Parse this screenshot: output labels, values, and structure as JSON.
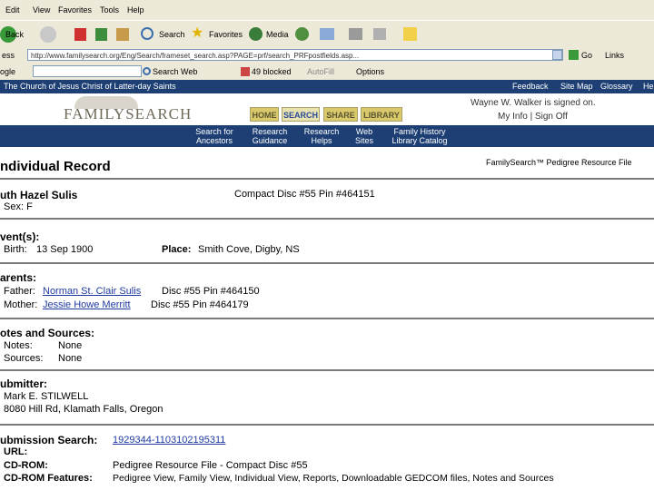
{
  "browser": {
    "menu": [
      "Edit",
      "View",
      "Favorites",
      "Tools",
      "Help"
    ],
    "toolbar": {
      "back": "Back",
      "search": "Search",
      "favorites": "Favorites",
      "media": "Media"
    },
    "address": {
      "label": "ess",
      "url": "http://www.familysearch.org/Eng/Search/frameset_search.asp?PAGE=prf/search_PRFpostfields.asp...",
      "go": "Go",
      "links": "Links"
    },
    "google": {
      "label": "ogle",
      "search_web": "Search Web",
      "blocked": "49 blocked",
      "autofill": "AutoFill",
      "options": "Options"
    }
  },
  "site": {
    "church": "The Church of Jesus Christ of Latter-day Saints",
    "top_links": [
      "Feedback",
      "Site Map",
      "Glossary",
      "He"
    ],
    "logo": "FAMILYSEARCH",
    "tabs": [
      "HOME",
      "SEARCH",
      "SHARE",
      "LIBRARY"
    ],
    "signed_in": "Wayne W. Walker is signed on.",
    "account_links": "My Info | Sign Off",
    "subnav": [
      [
        "Search for",
        "Ancestors"
      ],
      [
        "Research",
        "Guidance"
      ],
      [
        "Research",
        "Helps"
      ],
      [
        "Web",
        "Sites"
      ],
      [
        "Family History",
        "Library Catalog"
      ]
    ]
  },
  "record": {
    "title": "ndividual Record",
    "source_file": "FamilySearch™ Pedigree Resource File",
    "name": "uth Hazel Sulis",
    "disc_pin": "Compact Disc #55   Pin #464151",
    "sex": "Sex: F",
    "events_heading": "vent(s):",
    "birth_label": "Birth:",
    "birth_date": "13 Sep 1900",
    "place_label": "Place:",
    "place": "Smith Cove, Digby, NS",
    "parents_heading": "arents:",
    "father_label": "Father:",
    "father": "Norman St. Clair Sulis",
    "father_ref": "Disc #55   Pin #464150",
    "mother_label": "Mother:",
    "mother": "Jessie Howe Merritt",
    "mother_ref": "Disc #55   Pin #464179",
    "notes_heading": "otes and Sources:",
    "notes_label": "Notes:",
    "notes_value": "None",
    "sources_label": "Sources:",
    "sources_value": "None",
    "submitter_heading": "ubmitter:",
    "submitter_name": "Mark E. STILWELL",
    "submitter_address": "8080 Hill Rd, Klamath Falls, Oregon",
    "submission_label": "ubmission Search:",
    "submission_id": "1929344-1103102195311",
    "url_label": "URL:",
    "cdrom_label": "CD-ROM:",
    "cdrom_value": "Pedigree Resource File - Compact Disc #55",
    "features_label": "CD-ROM Features:",
    "features_value": "Pedigree View, Family View, Individual View, Reports, Downloadable GEDCOM files, Notes and Sources"
  },
  "colors": {
    "site_blue": "#1d3f73",
    "tab_gold": "#d9c96b",
    "tab_active": "#e7e2b0",
    "link": "#1f3aa0"
  }
}
